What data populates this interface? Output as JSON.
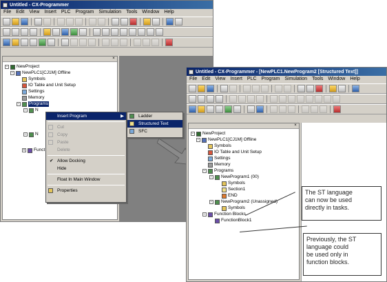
{
  "window1": {
    "title": "Untitled - CX-Programmer",
    "menu": [
      "File",
      "Edit",
      "View",
      "Insert",
      "PLC",
      "Program",
      "Simulation",
      "Tools",
      "Window",
      "Help"
    ],
    "tree": {
      "project": "NewProject",
      "plc": "NewPLC1[CJ1M] Offline",
      "items": [
        "Symbols",
        "IO Table and Unit Setup",
        "Settings",
        "Memory",
        "Programs"
      ],
      "partial_n1": "N",
      "partial_n2": "N",
      "function": "Funct"
    },
    "context_menu": {
      "items": [
        {
          "label": "Insert Program",
          "selected": true,
          "submenu": true
        },
        {
          "label": "Cut",
          "disabled": true
        },
        {
          "label": "Copy",
          "disabled": true
        },
        {
          "label": "Paste",
          "disabled": true
        },
        {
          "label": "Delete",
          "disabled": true
        },
        {
          "label": "Allow Docking",
          "checked": true
        },
        {
          "label": "Hide"
        },
        {
          "label": "Float In Main Window"
        },
        {
          "label": "Properties"
        }
      ],
      "submenu": [
        "Ladder",
        "Structured Text",
        "SFC"
      ],
      "submenu_selected": "Structured Text"
    }
  },
  "window2": {
    "title": "Untitled - CX-Programmer - [NewPLC1.NewProgram2 [Structured Text]]",
    "menu": [
      "File",
      "Edit",
      "View",
      "Insert",
      "PLC",
      "Program",
      "Simulation",
      "Tools",
      "Window",
      "Help"
    ],
    "tree": {
      "project": "NewProject",
      "plc": "NewPLC1[CJ1M] Offline",
      "items": [
        "Symbols",
        "IO Table and Unit Setup",
        "Settings",
        "Memory",
        "Programs"
      ],
      "program1": "NewProgram1 (00)",
      "program1_children": [
        "Symbols",
        "Section1",
        "END"
      ],
      "program2": "NewProgram2 (Unassigned)",
      "program2_children": [
        "Symbols"
      ],
      "function_blocks": "Function Blocks",
      "function_block1": "FunctionBlock1"
    }
  },
  "callouts": {
    "first": [
      "The ST language",
      "can now be used",
      "directly in tasks."
    ],
    "second": [
      "Previously, the ST",
      "language could",
      "be used only in",
      "function blocks."
    ]
  },
  "colors": {
    "titlebar": "#0a246a",
    "window_bg": "#d4d0c8",
    "workspace": "#808080",
    "arrow": "#666666"
  }
}
